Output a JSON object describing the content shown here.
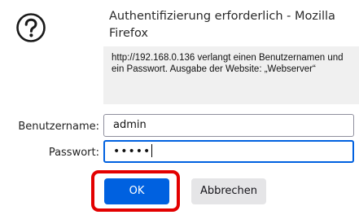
{
  "dialog": {
    "title": "Authentifizierung erforderlich - Mozilla Firefox",
    "message": "http://192.168.0.136 verlangt einen Benutzernamen und ein Passwort. Ausgabe der Website: „Webserver“",
    "icon": "help-circle-icon"
  },
  "form": {
    "username_label": "Benutzername:",
    "username_value": "admin",
    "password_label": "Passwort:",
    "password_mask": "•••••"
  },
  "buttons": {
    "ok_label": "OK",
    "cancel_label": "Abbrechen"
  },
  "colors": {
    "accent": "#0061e0",
    "highlight": "#e30000",
    "message_bg": "#f0f0f0"
  }
}
